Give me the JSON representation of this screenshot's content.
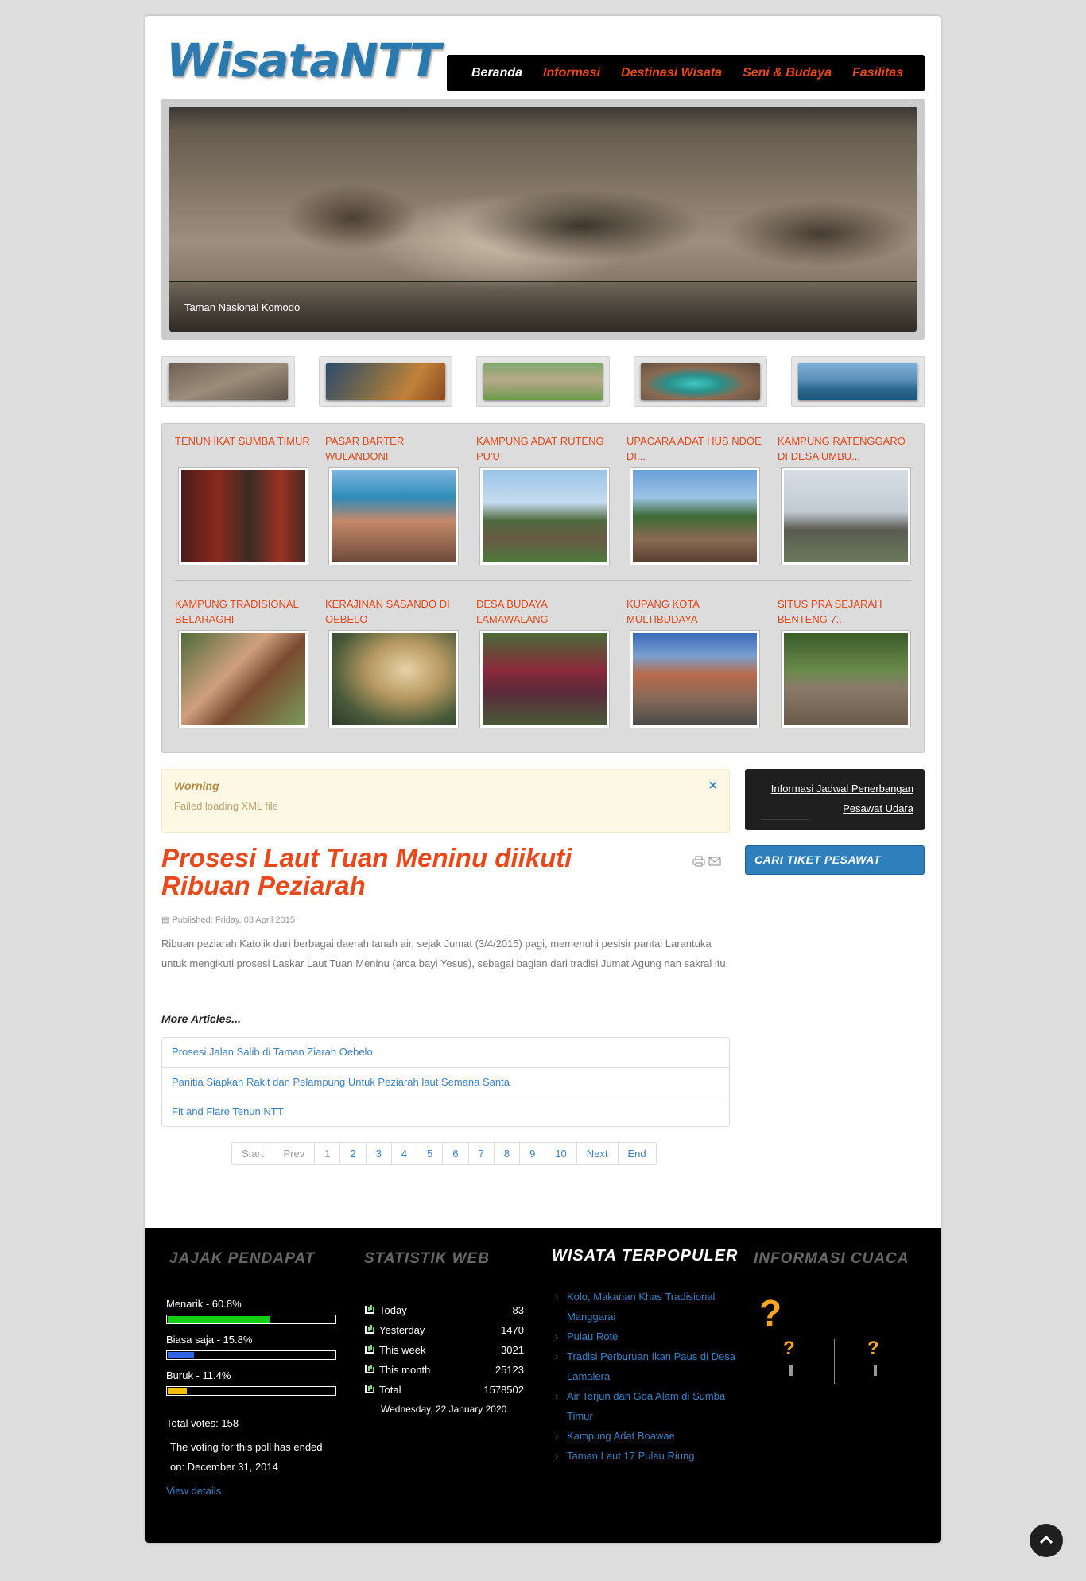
{
  "header": {
    "logo": "WisataNTT"
  },
  "nav": [
    "Beranda",
    "Informasi",
    "Destinasi Wisata",
    "Seni & Budaya",
    "Fasilitas"
  ],
  "hero": {
    "caption": "Taman Nasional Komodo"
  },
  "colors": {
    "accent": "#e8491c",
    "link": "#3f7fbe",
    "logo": "#2a7ab0"
  },
  "gallery": [
    {
      "title": "TENUN IKAT SUMBA TIMUR"
    },
    {
      "title": "PASAR BARTER WULANDONI"
    },
    {
      "title": "KAMPUNG ADAT RUTENG PU'U"
    },
    {
      "title": "UPACARA ADAT HUS NDOE DI..."
    },
    {
      "title": "KAMPUNG RATENGGARO DI DESA UMBU..."
    },
    {
      "title": "KAMPUNG TRADISIONAL BELARAGHI"
    },
    {
      "title": "KERAJINAN SASANDO DI OEBELO"
    },
    {
      "title": "DESA BUDAYA LAMAWALANG"
    },
    {
      "title": "KUPANG KOTA MULTIBUDAYA"
    },
    {
      "title": "SITUS PRA SEJARAH BENTENG 7.."
    }
  ],
  "warning": {
    "heading": "Worning",
    "message": "Failed loading XML file",
    "close": "×"
  },
  "article": {
    "title": "Prosesi Laut Tuan Meninu diikuti Ribuan Peziarah",
    "published": "Published: Friday, 03 April 2015",
    "body": "Ribuan peziarah Katolik dari berbagai daerah tanah air, sejak Jumat (3/4/2015) pagi, memenuhi pesisir pantai Larantuka untuk mengikuti prosesi Laskar Laut Tuan Meninu (arca bayi Yesus), sebagai bagian dari tradisi Jumat Agung nan sakral itu.",
    "print_icon": "print-icon",
    "email_icon": "email-icon"
  },
  "more": {
    "heading": "More Articles...",
    "items": [
      "Prosesi Jalan Salib di Taman Ziarah Oebelo",
      "Panitia Siapkan Rakit dan Pelampung Untuk Peziarah laut Semana Santa",
      "Fit and Flare Tenun NTT"
    ]
  },
  "pagination": [
    "Start",
    "Prev",
    "1",
    "2",
    "3",
    "4",
    "5",
    "6",
    "7",
    "8",
    "9",
    "10",
    "Next",
    "End"
  ],
  "sidebar": {
    "flight_line1": "Informasi Jadwal Penerbangan",
    "flight_line2": "Pesawat Udara",
    "ticket_button": "CARI TIKET PESAWAT"
  },
  "footer": {
    "poll": {
      "heading": "JAJAK PENDAPAT",
      "options": [
        {
          "label": "Menarik - 60.8%",
          "value": 0.608,
          "color": "#10d010"
        },
        {
          "label": "Biasa saja - 15.8%",
          "value": 0.158,
          "color": "#2f66e8"
        },
        {
          "label": "Buruk - 11.4%",
          "value": 0.114,
          "color": "#f0c000"
        }
      ],
      "total": "Total votes: 158",
      "ended": "The voting for this poll has ended on: December 31, 2014",
      "details": "View details"
    },
    "stats": {
      "heading": "STATISTIK WEB",
      "rows": [
        {
          "label": "Today",
          "value": "83"
        },
        {
          "label": "Yesterday",
          "value": "1470"
        },
        {
          "label": "This week",
          "value": "3021"
        },
        {
          "label": "This month",
          "value": "25123"
        },
        {
          "label": "Total",
          "value": "1578502"
        }
      ],
      "date": "Wednesday, 22 January 2020"
    },
    "popular": {
      "heading": "WISATA TERPOPULER",
      "items": [
        "Kolo, Makanan Khas Tradisional Manggarai",
        "Pulau Rote",
        "Tradisi Perburuan Ikan Paus di Desa Lamalera",
        "Air Terjun dan Goa Alam di Sumba Timur",
        "Kampung Adat Boawae",
        "Taman Laut 17 Pulau Riung"
      ]
    },
    "weather": {
      "heading": "INFORMASI CUACA",
      "big": "?",
      "small1": "?",
      "small2": "?"
    }
  },
  "scroll_top": "^"
}
